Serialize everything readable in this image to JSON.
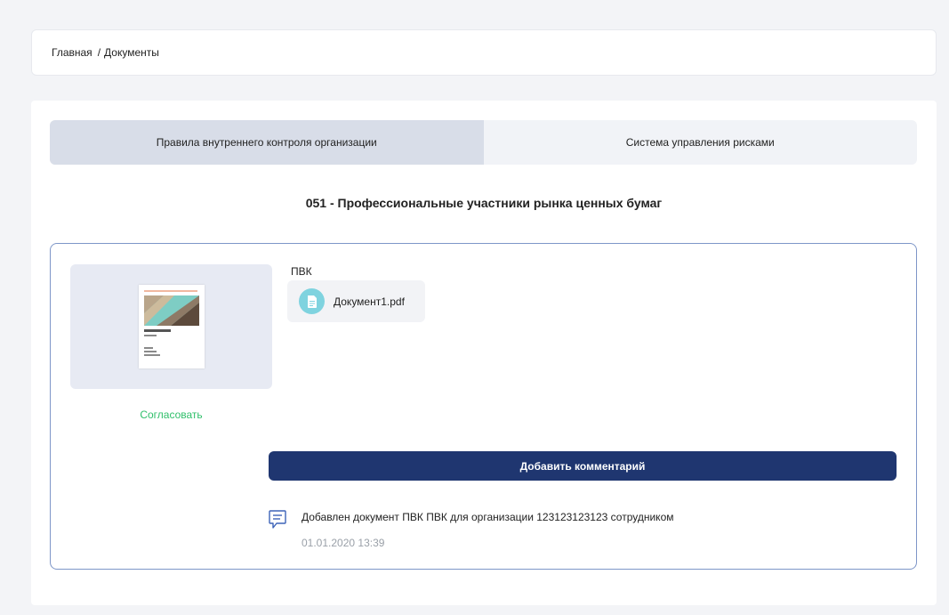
{
  "breadcrumb": {
    "home": "Главная",
    "separator": "/",
    "current": "Документы"
  },
  "tabs": [
    {
      "label": "Правила внутреннего контроля организации",
      "active": true
    },
    {
      "label": "Система управления рисками",
      "active": false
    }
  ],
  "section": {
    "title": "051 - Профессиональные участники рынка ценных бумаг"
  },
  "document_card": {
    "thumbnail_icon": "document-preview",
    "approve_label": "Согласовать",
    "group_label": "ПВК",
    "file": {
      "icon": "file-icon",
      "name": "Документ1.pdf"
    },
    "add_comment_label": "Добавить комментарий",
    "comment": {
      "icon": "comment-icon",
      "text": "Добавлен документ ПВК ПВК для организации 123123123123 сотрудником",
      "date": "01.01.2020 13:39"
    }
  },
  "colors": {
    "primary_button": "#1f3670",
    "approve_text": "#2fbf6a",
    "card_border": "#7e96c8",
    "file_icon_bg": "#7fd3df",
    "active_tab": "#d8dde8"
  }
}
